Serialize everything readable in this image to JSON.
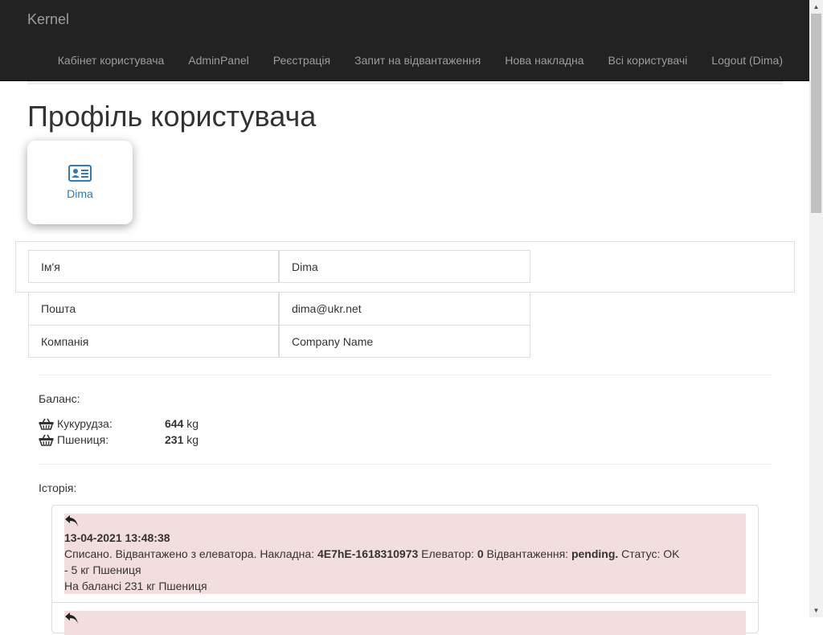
{
  "brand": "Kernel",
  "nav": {
    "items": [
      "Кабінет користувача",
      "AdminPanel",
      "Реєстрація",
      "Запит на відвантаження",
      "Нова накладна",
      "Всі користувачі",
      "Logout (Dima)"
    ]
  },
  "page": {
    "title": "Профіль користувача"
  },
  "profile_card": {
    "icon": "id-card-icon",
    "name": "Dima"
  },
  "profile_table": {
    "rows": [
      {
        "label": "Ім'я",
        "value": "Dima"
      },
      {
        "label": "Пошта",
        "value": "dima@ukr.net"
      },
      {
        "label": "Компанія",
        "value": "Company Name"
      }
    ]
  },
  "balance": {
    "label": "Баланс:",
    "items": [
      {
        "icon": "basket-icon",
        "name": "Кукурудза:",
        "amount": "644",
        "unit": "kg"
      },
      {
        "icon": "basket-icon",
        "name": "Пшениця:",
        "amount": "231",
        "unit": "kg"
      }
    ]
  },
  "history": {
    "label": "Історія:",
    "entries": [
      {
        "icon": "undo-arrow-icon",
        "datetime": "13-04-2021 13:48:38",
        "desc_prefix": "Списано. Відвантажено з елеватора. Накладна: ",
        "invoice": "4E7hE-1618310973",
        "elevator_label": " Елеватор: ",
        "elevator": "0",
        "shipment_label": " Відвантаження: ",
        "shipment": "pending.",
        "status_text": " Статус: OK",
        "change": "- 5 кг Пшениця",
        "balance_after": "На балансі 231 кг Пшениця"
      }
    ]
  },
  "colors": {
    "navbar": "#222222",
    "link": "#337ab7",
    "history_bg": "#f2dede"
  }
}
